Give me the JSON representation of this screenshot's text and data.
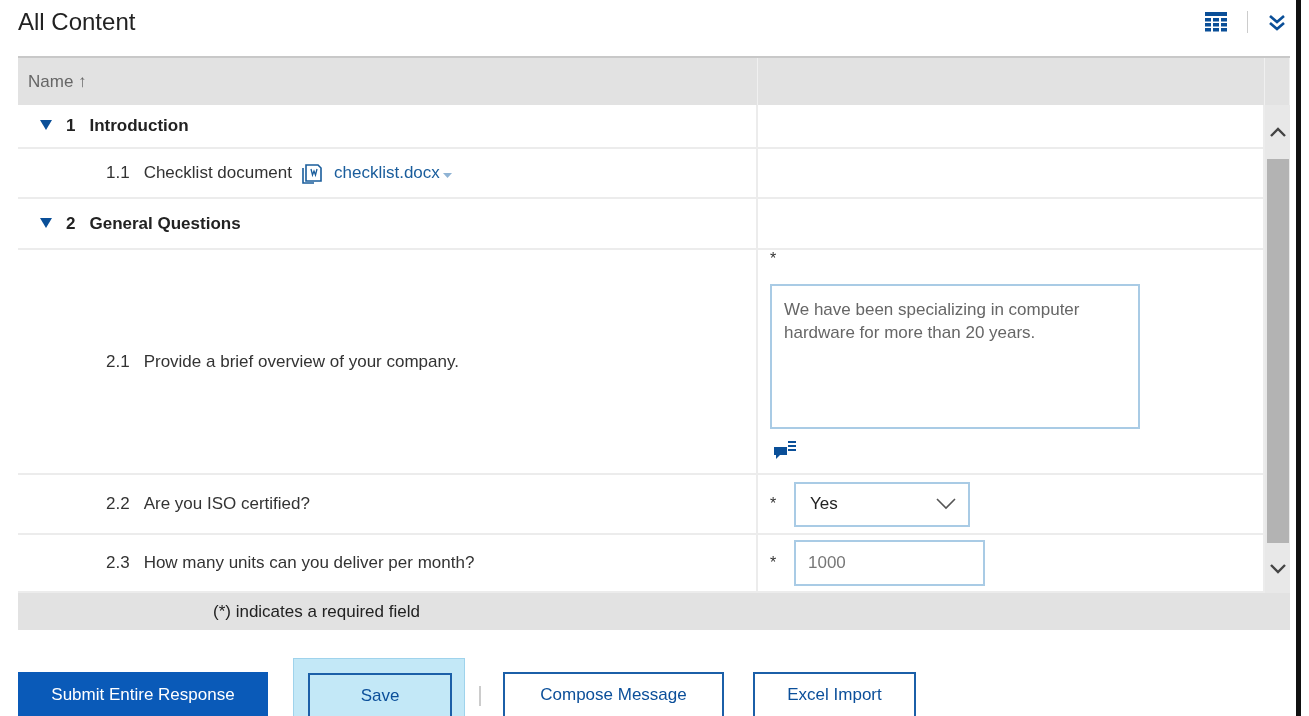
{
  "title": "All Content",
  "table": {
    "columns": [
      {
        "label": "Name",
        "sort_icon": "↑"
      },
      {}
    ],
    "rows": [
      {
        "kind": "section",
        "number": "1",
        "label": "Introduction",
        "expanded": true,
        "children": [
          {
            "kind": "attachment",
            "number": "1.1",
            "label": "Checklist document",
            "file": "checklist.docx"
          }
        ]
      },
      {
        "kind": "section",
        "number": "2",
        "label": "General Questions",
        "expanded": true,
        "children": [
          {
            "kind": "textarea",
            "number": "2.1",
            "label": "Provide a brief overview of your company.",
            "required_mark": "*",
            "value": "We have been specializing in computer hardware for more than 20 years."
          },
          {
            "kind": "select",
            "number": "2.2",
            "label": "Are you ISO certified?",
            "required_mark": "*",
            "value": "Yes"
          },
          {
            "kind": "input",
            "number": "2.3",
            "label": "How many units can you deliver per month?",
            "required_mark": "*",
            "placeholder": "1000"
          }
        ]
      }
    ],
    "footer": "(*) indicates a required field"
  },
  "buttons": [
    {
      "label": "Submit Entire Response",
      "kind": "primary",
      "hovered": false
    },
    {
      "label": "Save",
      "kind": "secondary",
      "hovered": true
    },
    {
      "label": "Compose Message",
      "kind": "secondary",
      "hovered": false
    },
    {
      "label": "Excel Import",
      "kind": "secondary",
      "hovered": false
    }
  ]
}
